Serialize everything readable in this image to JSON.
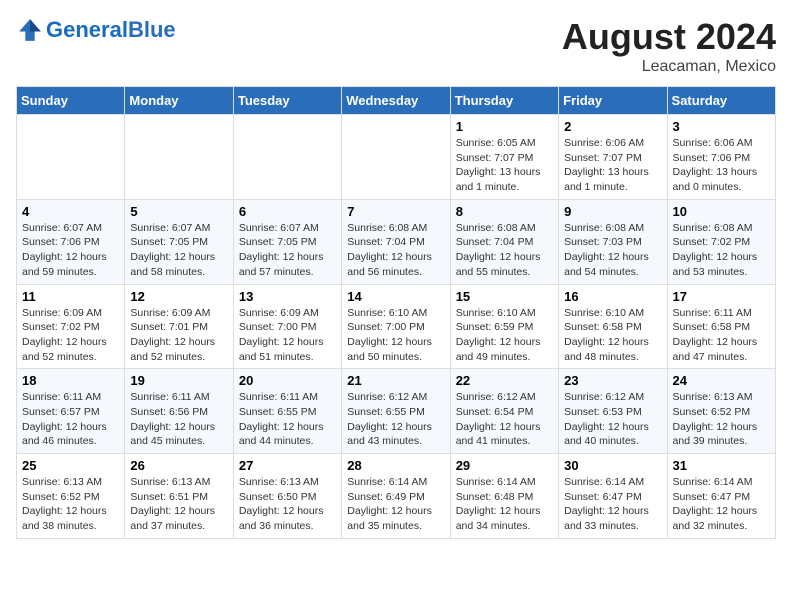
{
  "header": {
    "logo_text_general": "General",
    "logo_text_blue": "Blue",
    "month_year": "August 2024",
    "location": "Leacaman, Mexico"
  },
  "days_of_week": [
    "Sunday",
    "Monday",
    "Tuesday",
    "Wednesday",
    "Thursday",
    "Friday",
    "Saturday"
  ],
  "weeks": [
    [
      {
        "day": "",
        "info": ""
      },
      {
        "day": "",
        "info": ""
      },
      {
        "day": "",
        "info": ""
      },
      {
        "day": "",
        "info": ""
      },
      {
        "day": "1",
        "info": "Sunrise: 6:05 AM\nSunset: 7:07 PM\nDaylight: 13 hours\nand 1 minute."
      },
      {
        "day": "2",
        "info": "Sunrise: 6:06 AM\nSunset: 7:07 PM\nDaylight: 13 hours\nand 1 minute."
      },
      {
        "day": "3",
        "info": "Sunrise: 6:06 AM\nSunset: 7:06 PM\nDaylight: 13 hours\nand 0 minutes."
      }
    ],
    [
      {
        "day": "4",
        "info": "Sunrise: 6:07 AM\nSunset: 7:06 PM\nDaylight: 12 hours\nand 59 minutes."
      },
      {
        "day": "5",
        "info": "Sunrise: 6:07 AM\nSunset: 7:05 PM\nDaylight: 12 hours\nand 58 minutes."
      },
      {
        "day": "6",
        "info": "Sunrise: 6:07 AM\nSunset: 7:05 PM\nDaylight: 12 hours\nand 57 minutes."
      },
      {
        "day": "7",
        "info": "Sunrise: 6:08 AM\nSunset: 7:04 PM\nDaylight: 12 hours\nand 56 minutes."
      },
      {
        "day": "8",
        "info": "Sunrise: 6:08 AM\nSunset: 7:04 PM\nDaylight: 12 hours\nand 55 minutes."
      },
      {
        "day": "9",
        "info": "Sunrise: 6:08 AM\nSunset: 7:03 PM\nDaylight: 12 hours\nand 54 minutes."
      },
      {
        "day": "10",
        "info": "Sunrise: 6:08 AM\nSunset: 7:02 PM\nDaylight: 12 hours\nand 53 minutes."
      }
    ],
    [
      {
        "day": "11",
        "info": "Sunrise: 6:09 AM\nSunset: 7:02 PM\nDaylight: 12 hours\nand 52 minutes."
      },
      {
        "day": "12",
        "info": "Sunrise: 6:09 AM\nSunset: 7:01 PM\nDaylight: 12 hours\nand 52 minutes."
      },
      {
        "day": "13",
        "info": "Sunrise: 6:09 AM\nSunset: 7:00 PM\nDaylight: 12 hours\nand 51 minutes."
      },
      {
        "day": "14",
        "info": "Sunrise: 6:10 AM\nSunset: 7:00 PM\nDaylight: 12 hours\nand 50 minutes."
      },
      {
        "day": "15",
        "info": "Sunrise: 6:10 AM\nSunset: 6:59 PM\nDaylight: 12 hours\nand 49 minutes."
      },
      {
        "day": "16",
        "info": "Sunrise: 6:10 AM\nSunset: 6:58 PM\nDaylight: 12 hours\nand 48 minutes."
      },
      {
        "day": "17",
        "info": "Sunrise: 6:11 AM\nSunset: 6:58 PM\nDaylight: 12 hours\nand 47 minutes."
      }
    ],
    [
      {
        "day": "18",
        "info": "Sunrise: 6:11 AM\nSunset: 6:57 PM\nDaylight: 12 hours\nand 46 minutes."
      },
      {
        "day": "19",
        "info": "Sunrise: 6:11 AM\nSunset: 6:56 PM\nDaylight: 12 hours\nand 45 minutes."
      },
      {
        "day": "20",
        "info": "Sunrise: 6:11 AM\nSunset: 6:55 PM\nDaylight: 12 hours\nand 44 minutes."
      },
      {
        "day": "21",
        "info": "Sunrise: 6:12 AM\nSunset: 6:55 PM\nDaylight: 12 hours\nand 43 minutes."
      },
      {
        "day": "22",
        "info": "Sunrise: 6:12 AM\nSunset: 6:54 PM\nDaylight: 12 hours\nand 41 minutes."
      },
      {
        "day": "23",
        "info": "Sunrise: 6:12 AM\nSunset: 6:53 PM\nDaylight: 12 hours\nand 40 minutes."
      },
      {
        "day": "24",
        "info": "Sunrise: 6:13 AM\nSunset: 6:52 PM\nDaylight: 12 hours\nand 39 minutes."
      }
    ],
    [
      {
        "day": "25",
        "info": "Sunrise: 6:13 AM\nSunset: 6:52 PM\nDaylight: 12 hours\nand 38 minutes."
      },
      {
        "day": "26",
        "info": "Sunrise: 6:13 AM\nSunset: 6:51 PM\nDaylight: 12 hours\nand 37 minutes."
      },
      {
        "day": "27",
        "info": "Sunrise: 6:13 AM\nSunset: 6:50 PM\nDaylight: 12 hours\nand 36 minutes."
      },
      {
        "day": "28",
        "info": "Sunrise: 6:14 AM\nSunset: 6:49 PM\nDaylight: 12 hours\nand 35 minutes."
      },
      {
        "day": "29",
        "info": "Sunrise: 6:14 AM\nSunset: 6:48 PM\nDaylight: 12 hours\nand 34 minutes."
      },
      {
        "day": "30",
        "info": "Sunrise: 6:14 AM\nSunset: 6:47 PM\nDaylight: 12 hours\nand 33 minutes."
      },
      {
        "day": "31",
        "info": "Sunrise: 6:14 AM\nSunset: 6:47 PM\nDaylight: 12 hours\nand 32 minutes."
      }
    ]
  ]
}
